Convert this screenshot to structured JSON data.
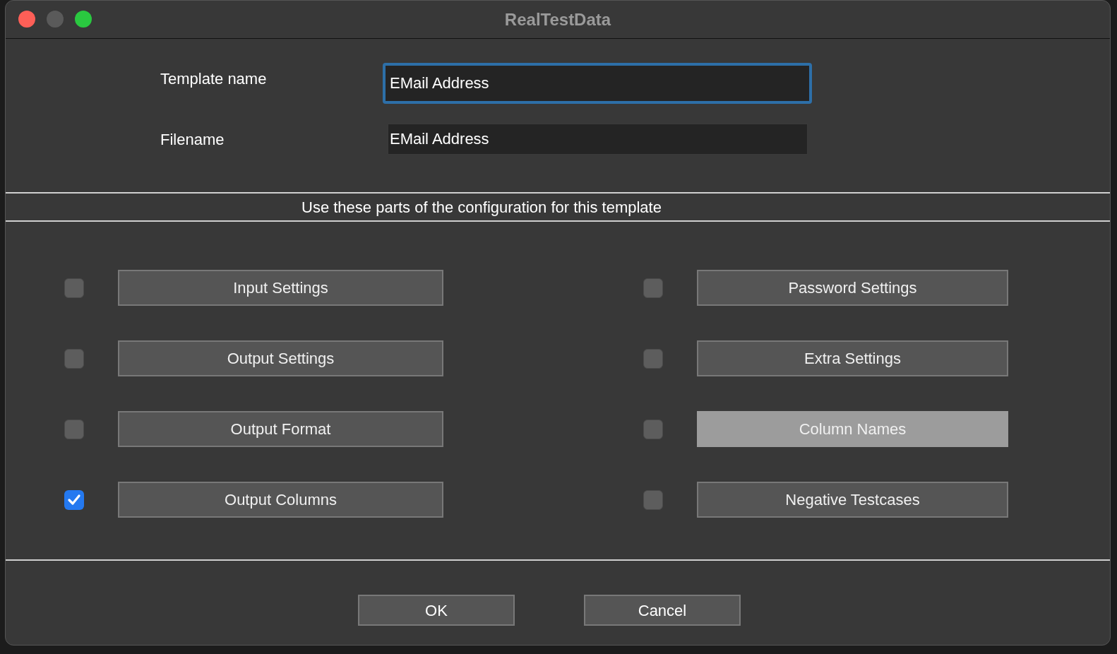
{
  "window": {
    "title": "RealTestData"
  },
  "fields": [
    {
      "label": "Template name",
      "value": "EMail Address",
      "focused": true
    },
    {
      "label": "Filename",
      "value": "EMail Address",
      "focused": false
    }
  ],
  "section_heading": "Use these parts of the configuration for this template",
  "options": [
    {
      "label": "Input Settings",
      "checked": false,
      "selected": false
    },
    {
      "label": "Password Settings",
      "checked": false,
      "selected": false
    },
    {
      "label": "Output Settings",
      "checked": false,
      "selected": false
    },
    {
      "label": "Extra Settings",
      "checked": false,
      "selected": false
    },
    {
      "label": "Output Format",
      "checked": false,
      "selected": false
    },
    {
      "label": "Column Names",
      "checked": false,
      "selected": true
    },
    {
      "label": "Output Columns",
      "checked": true,
      "selected": false
    },
    {
      "label": "Negative Testcases",
      "checked": false,
      "selected": false
    }
  ],
  "buttons": [
    "OK",
    "Cancel"
  ]
}
